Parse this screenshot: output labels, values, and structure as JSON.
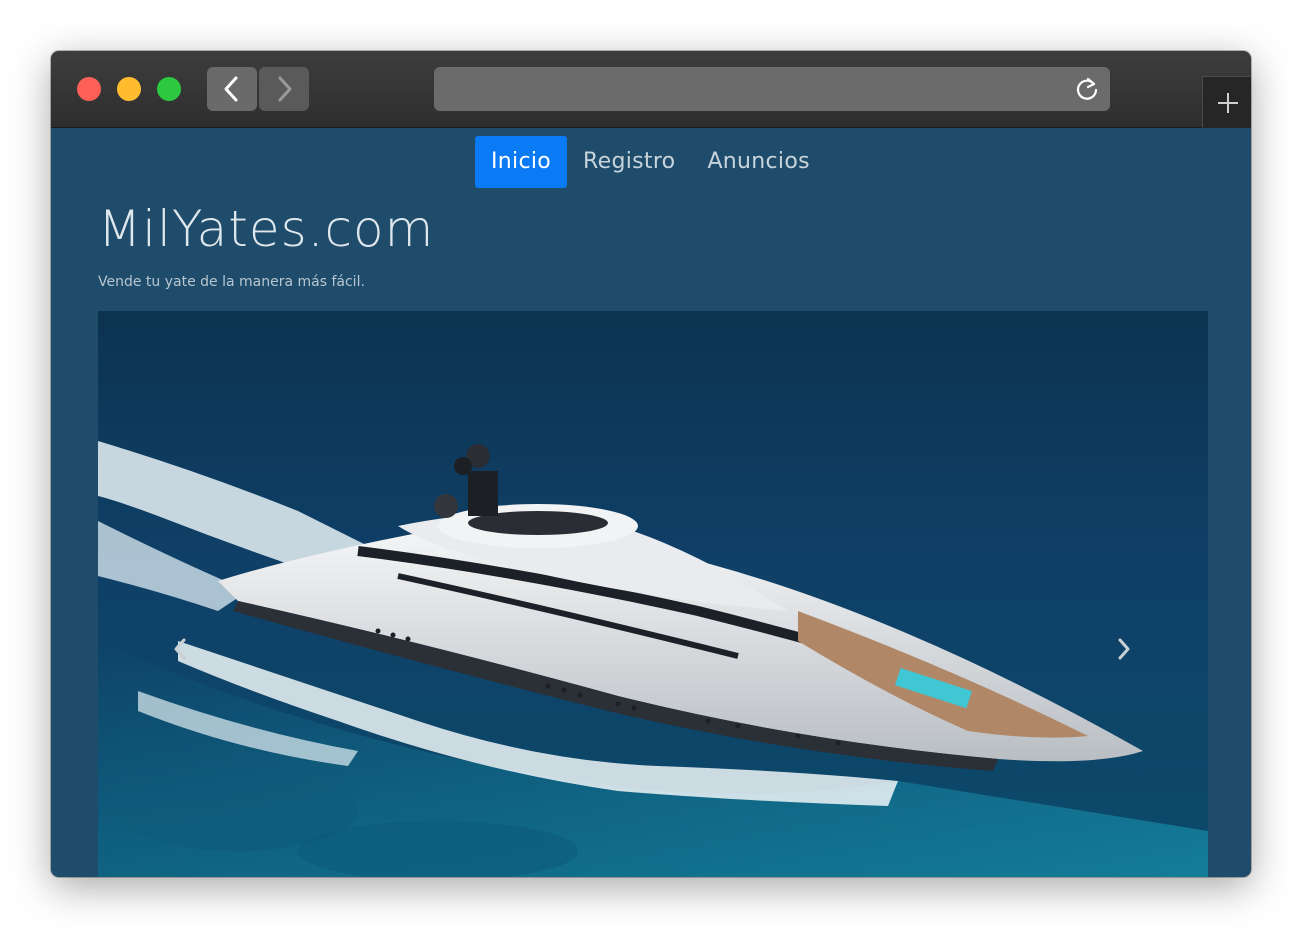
{
  "browser": {
    "url": "",
    "traffic_lights": [
      "close",
      "minimize",
      "zoom"
    ],
    "icons": {
      "back": "chevron-left-icon",
      "forward": "chevron-right-icon",
      "reload": "reload-icon",
      "new_tab": "plus-icon"
    }
  },
  "nav": {
    "items": [
      {
        "label": "Inicio",
        "active": true
      },
      {
        "label": "Registro",
        "active": false
      },
      {
        "label": "Anuncios",
        "active": false
      }
    ]
  },
  "hero": {
    "title": "MilYates.com",
    "tagline": "Vende tu yate de la manera más fácil."
  },
  "carousel": {
    "image": "yacht-photo",
    "prev_icon": "chevron-left-icon",
    "next_icon": "chevron-right-icon"
  },
  "colors": {
    "page_background": "#1f4c6b",
    "active_nav": "#0a7bf5",
    "nav_text": "#c8d4dc"
  }
}
